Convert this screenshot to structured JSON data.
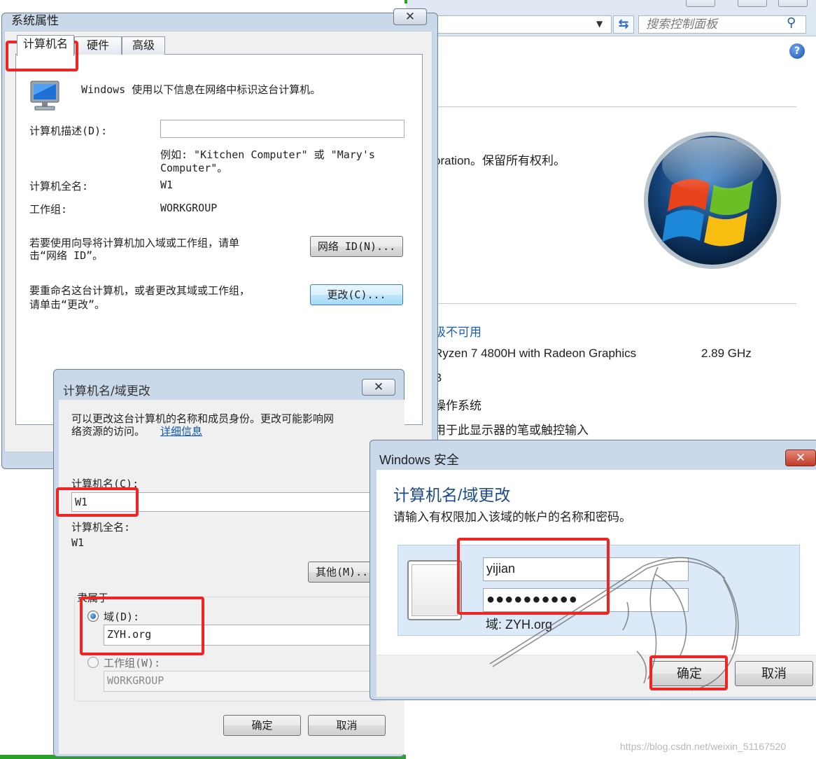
{
  "background": {
    "search_placeholder": "搜索控制面板",
    "help_glyph": "?",
    "copyright_fragment": "oration。保留所有权利。",
    "rating_fragment": "级不可用",
    "cpu_fragment": "Ryzen 7 4800H with Radeon Graphics",
    "cpu_speed": "2.89 GHz",
    "ram_fragment": "B",
    "system_type_fragment": "操作系统",
    "pen_fragment": "用于此显示器的笔或触控输入",
    "watermark": "https://blog.csdn.net/weixin_51167520"
  },
  "system_properties": {
    "title": "系统属性",
    "close_glyph": "✕",
    "tabs": [
      "计算机名",
      "硬件",
      "高级"
    ],
    "intro": "Windows 使用以下信息在网络中标识这台计算机。",
    "description_label": "计算机描述(D):",
    "description_value": "",
    "example_line1": "例如: \"Kitchen Computer\" 或 \"Mary's",
    "example_line2": "Computer\"。",
    "full_name_label": "计算机全名:",
    "full_name_value": "W1",
    "workgroup_label": "工作组:",
    "workgroup_value": "WORKGROUP",
    "network_id_text_line1": "若要使用向导将计算机加入域或工作组，请单",
    "network_id_text_line2": "击“网络 ID”。",
    "network_id_button": "网络 ID(N)...",
    "rename_text_line1": "要重命名这台计算机，或者更改其域或工作组，",
    "rename_text_line2": "请单击“更改”。",
    "change_button": "更改(C)..."
  },
  "computer_name_dialog": {
    "title": "计算机名/域更改",
    "close_glyph": "✕",
    "description_line1": "可以更改这台计算机的名称和成员身份。更改可能影响网",
    "description_line2": "络资源的访问。",
    "more_info_link": "详细信息",
    "computer_name_label": "计算机名(C):",
    "computer_name_value": "W1",
    "full_name_label": "计算机全名:",
    "full_name_value": "W1",
    "more_button": "其他(M)...",
    "member_of_label": "隶属于",
    "domain_label": "域(D):",
    "domain_value": "ZYH.org",
    "domain_selected": true,
    "workgroup_label": "工作组(W):",
    "workgroup_value": "WORKGROUP",
    "ok_button": "确定",
    "cancel_button": "取消"
  },
  "windows_security": {
    "title": "Windows 安全",
    "close_glyph": "✕",
    "heading": "计算机名/域更改",
    "instruction": "请输入有权限加入该域的帐户的名称和密码。",
    "username_value": "yijian",
    "password_value": "●●●●●●●●●●",
    "domain_line": "域: ZYH.org",
    "ok_button": "确定",
    "cancel_button": "取消"
  },
  "colors": {
    "annotation_red": "#f12424",
    "window_frame": "#c9d9ea",
    "link_blue": "#0a58b8",
    "heading_blue": "#1d4a8c"
  }
}
